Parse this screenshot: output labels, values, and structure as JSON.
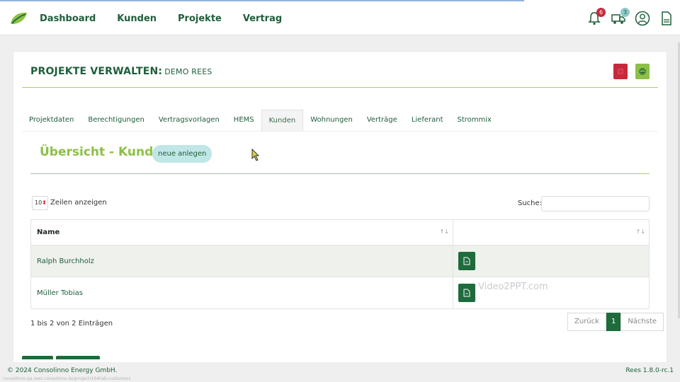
{
  "nav": {
    "items": [
      "Dashboard",
      "Kunden",
      "Projekte",
      "Vertrag"
    ]
  },
  "top_icons": [
    {
      "name": "bell-icon",
      "badge": "6",
      "badge_color": "#c8283c"
    },
    {
      "name": "truck-icon",
      "badge": "3",
      "badge_color": "#8fc9c8"
    },
    {
      "name": "user-circle-icon"
    },
    {
      "name": "document-icon"
    }
  ],
  "page": {
    "title": "PROJEKTE VERWALTEN:",
    "subtitle": "DEMO REES"
  },
  "tabs": [
    {
      "label": "Projektdaten",
      "active": false
    },
    {
      "label": "Berechtigungen",
      "active": false
    },
    {
      "label": "Vertragsvorlagen",
      "active": false
    },
    {
      "label": "HEMS",
      "active": false
    },
    {
      "label": "Kunden",
      "active": true
    },
    {
      "label": "Wohnungen",
      "active": false
    },
    {
      "label": "Verträge",
      "active": false
    },
    {
      "label": "Lieferant",
      "active": false
    },
    {
      "label": "Strommix",
      "active": false
    }
  ],
  "section": {
    "title": "Übersicht - Kunden",
    "new_button": "neue anlegen"
  },
  "table_controls": {
    "length_value": "10",
    "length_label": "Zeilen anzeigen",
    "search_label": "Suche:",
    "search_value": ""
  },
  "table": {
    "columns": [
      "Name",
      ""
    ],
    "rows": [
      {
        "name": "Ralph Burchholz"
      },
      {
        "name": "Müller Tobias"
      }
    ]
  },
  "pagination": {
    "info": "1 bis 2 von 2 Einträgen",
    "prev": "Zurück",
    "current": "1",
    "next": "Nächste"
  },
  "watermark": "Video2PPT.com",
  "footer": {
    "copyright": "© 2024 Consolinno Energy GmbH.",
    "version": "Rees 1.8.0-rc.1",
    "url": "consolinno.qa.rees.consolinno.de/project/16#tab-customers"
  },
  "colors": {
    "brand_dark_green": "#1e5e3a",
    "accent_light_green": "#8dc046",
    "button_dark_green": "#1e6b3c",
    "danger_red": "#c8283c",
    "teal_pill": "#c0e6e6"
  }
}
